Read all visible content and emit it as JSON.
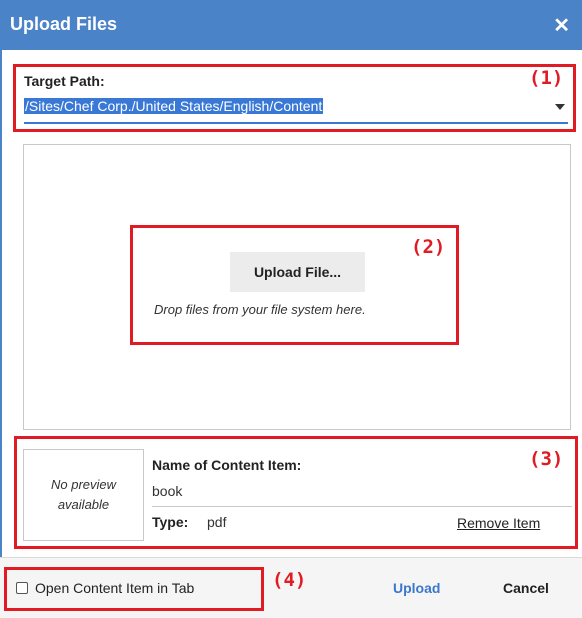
{
  "dialog": {
    "title": "Upload Files",
    "close_icon": "close-icon"
  },
  "target_path": {
    "label": "Target Path:",
    "value": "/Sites/Chef Corp./United States/English/Content",
    "dropdown_icon": "chevron-down-icon"
  },
  "dropzone": {
    "button_label": "Upload File...",
    "hint": "Drop files from your file system here."
  },
  "item": {
    "preview_text": "No preview available",
    "name_label": "Name of Content Item:",
    "name_value": "book",
    "type_label": "Type:",
    "type_value": "pdf",
    "remove_label": "Remove Item"
  },
  "footer": {
    "checkbox_label": "Open Content Item in Tab",
    "checkbox_checked": false,
    "upload_label": "Upload",
    "cancel_label": "Cancel"
  },
  "annotations": [
    "(1)",
    "(2)",
    "(3)",
    "(4)"
  ],
  "colors": {
    "header": "#4a83c8",
    "selection": "#3a78d6",
    "annotation": "#e01b24",
    "link": "#3b78cc"
  }
}
